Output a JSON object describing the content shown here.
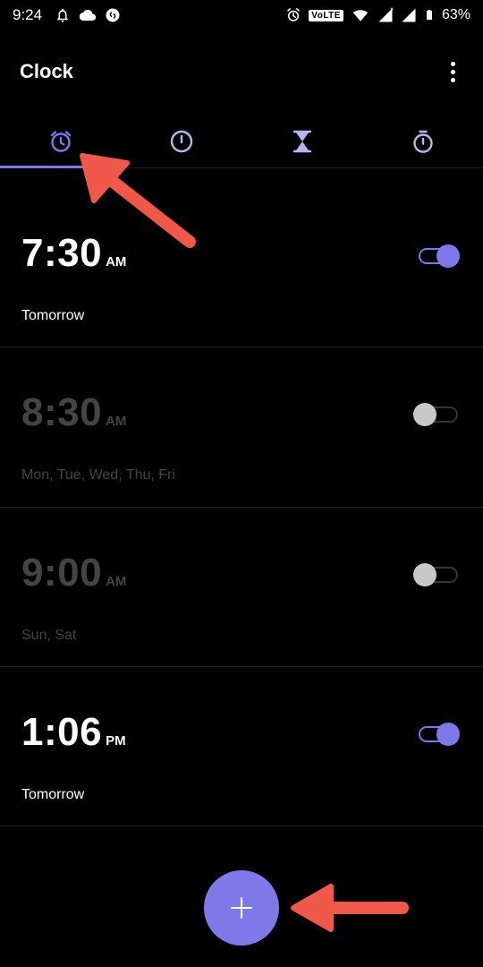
{
  "status_bar": {
    "time": "9:24",
    "network_badge": "VoLTE",
    "battery_percent": "63%",
    "left_icons": [
      "notification-bell-icon",
      "cloud-icon",
      "shazam-icon"
    ],
    "right_icons": [
      "alarm-icon",
      "volte-badge",
      "wifi-icon",
      "signal-icon",
      "signal-icon",
      "battery-icon"
    ]
  },
  "app_bar": {
    "title": "Clock",
    "overflow_icon": "more-vert-icon"
  },
  "tabs": [
    {
      "name": "alarm",
      "icon": "alarm-clock-icon",
      "active": true
    },
    {
      "name": "clock",
      "icon": "clock-icon",
      "active": false
    },
    {
      "name": "timer",
      "icon": "hourglass-icon",
      "active": false
    },
    {
      "name": "stopwatch",
      "icon": "stopwatch-icon",
      "active": false
    }
  ],
  "alarms": [
    {
      "time": "7:30",
      "ampm": "AM",
      "days": "Tomorrow",
      "enabled": true
    },
    {
      "time": "8:30",
      "ampm": "AM",
      "days": "Mon, Tue, Wed, Thu, Fri",
      "enabled": false
    },
    {
      "time": "9:00",
      "ampm": "AM",
      "days": "Sun, Sat",
      "enabled": false
    },
    {
      "time": "1:06",
      "ampm": "PM",
      "days": "Tomorrow",
      "enabled": true
    }
  ],
  "fab": {
    "icon": "plus-icon"
  },
  "colors": {
    "accent": "#7e78e8",
    "background": "#000000",
    "annotation_arrow": "#f0584a",
    "disabled_text": "#444444"
  }
}
